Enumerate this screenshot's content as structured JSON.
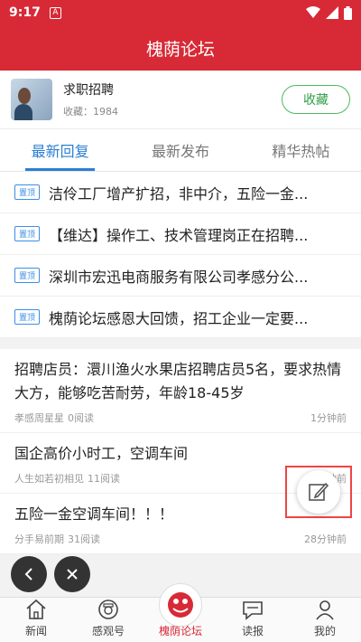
{
  "status_bar": {
    "time": "9:17",
    "notif_glyph": "A"
  },
  "app_bar": {
    "title": "槐荫论坛"
  },
  "forum": {
    "name": "求职招聘",
    "meta": "收藏：1984",
    "fav_label": "收藏"
  },
  "tabs": [
    {
      "label": "最新回复"
    },
    {
      "label": "最新发布"
    },
    {
      "label": "精华热帖"
    }
  ],
  "pinned": [
    {
      "badge": "置顶",
      "title": "洁伶工厂增产扩招，非中介，五险一金..."
    },
    {
      "badge": "置顶",
      "title": "【维达】操作工、技术管理岗正在招聘..."
    },
    {
      "badge": "置顶",
      "title": "深圳市宏迅电商服务有限公司孝感分公..."
    },
    {
      "badge": "置顶",
      "title": "槐荫论坛感恩大回馈，招工企业一定要..."
    }
  ],
  "posts": [
    {
      "title": "招聘店员：澴川渔火水果店招聘店员5名，要求热情大方，能够吃苦耐劳，年龄18-45岁",
      "author": "孝感周星星",
      "reads": "0阅读",
      "time": "1分钟前"
    },
    {
      "title": "国企高价小时工，空调车间",
      "author": "人生如若初相见",
      "reads": "11阅读",
      "time": "2分钟前"
    },
    {
      "title": "五险一金空调车间！！！",
      "author": "分手易前期",
      "reads": "31阅读",
      "time": "28分钟前"
    }
  ],
  "bottom_nav": [
    {
      "label": "新闻",
      "icon": "house-icon"
    },
    {
      "label": "感观号",
      "icon": "camera-circle-icon"
    },
    {
      "label": "槐荫论坛",
      "icon": "forum-logo-icon"
    },
    {
      "label": "读报",
      "icon": "chat-bubble-icon"
    },
    {
      "label": "我的",
      "icon": "person-icon"
    }
  ],
  "colors": {
    "brand_red": "#d72a36",
    "tab_blue": "#2a7fd3",
    "fav_green": "#4cbb5f"
  }
}
